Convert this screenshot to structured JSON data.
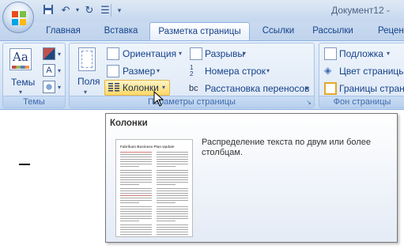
{
  "titlebar": {
    "doc_title": "Документ12 -"
  },
  "qat": {
    "icons": [
      "save-icon",
      "undo-icon",
      "redo-icon",
      "bullets-icon",
      "customize-icon"
    ]
  },
  "tabs": [
    {
      "label": "Главная"
    },
    {
      "label": "Вставка"
    },
    {
      "label": "Разметка страницы"
    },
    {
      "label": "Ссылки"
    },
    {
      "label": "Рассылки"
    },
    {
      "label": "Рецен"
    }
  ],
  "active_tab": "Разметка страницы",
  "ribbon": {
    "themes_group": {
      "themes_label": "Темы",
      "group_label": "Темы"
    },
    "page_setup": {
      "orientation": "Ориентация",
      "size": "Размер",
      "columns": "Колонки",
      "fields": "Поля",
      "breaks": "Разрывы",
      "line_numbers": "Номера строк",
      "hyphenation": "Расстановка переносов",
      "group_label": "Параметры страницы"
    },
    "page_background": {
      "watermark": "Подложка",
      "page_color": "Цвет страницы",
      "page_borders": "Границы страни",
      "group_label": "Фон страницы"
    }
  },
  "tooltip": {
    "title": "Колонки",
    "description": "Распределение текста по двум или более столбцам.",
    "thumbnail_title": "Fabrikam Business Plan Update"
  },
  "colors": {
    "ribbon_bg": "#d5e3f4",
    "text": "#15428b",
    "highlight": "#ffd966"
  }
}
